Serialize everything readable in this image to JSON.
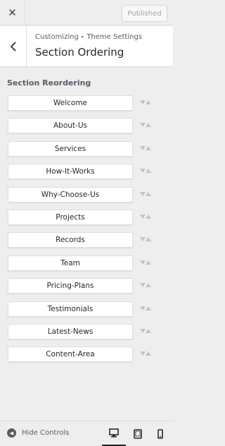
{
  "topbar": {
    "close_icon": "close-icon",
    "publish_label": "Published"
  },
  "header": {
    "back_icon": "chevron-left-icon",
    "breadcrumb_root": "Customizing",
    "breadcrumb_separator_icon": "triangle-right-icon",
    "breadcrumb_section": "Theme Settings",
    "title": "Section Ordering"
  },
  "section": {
    "label": "Section Reordering",
    "items": [
      {
        "label": "Welcome"
      },
      {
        "label": "About-Us"
      },
      {
        "label": "Services"
      },
      {
        "label": "How-It-Works"
      },
      {
        "label": "Why-Choose-Us"
      },
      {
        "label": "Projects"
      },
      {
        "label": "Records"
      },
      {
        "label": "Team"
      },
      {
        "label": "Pricing-Plans"
      },
      {
        "label": "Testimonials"
      },
      {
        "label": "Latest-News"
      },
      {
        "label": "Content-Area"
      }
    ],
    "move_icons": [
      "move-down-icon",
      "move-up-icon"
    ]
  },
  "footer": {
    "hide_controls_label": "Hide Controls",
    "hide_controls_icon": "collapse-left-icon",
    "devices": [
      {
        "name": "desktop-icon",
        "active": true
      },
      {
        "name": "tablet-icon",
        "active": false
      },
      {
        "name": "mobile-icon",
        "active": false
      }
    ]
  },
  "colors": {
    "background": "#eeeeee",
    "panel": "#ffffff",
    "border": "#dddddd",
    "text": "#23282d",
    "muted": "#a0a5aa"
  }
}
